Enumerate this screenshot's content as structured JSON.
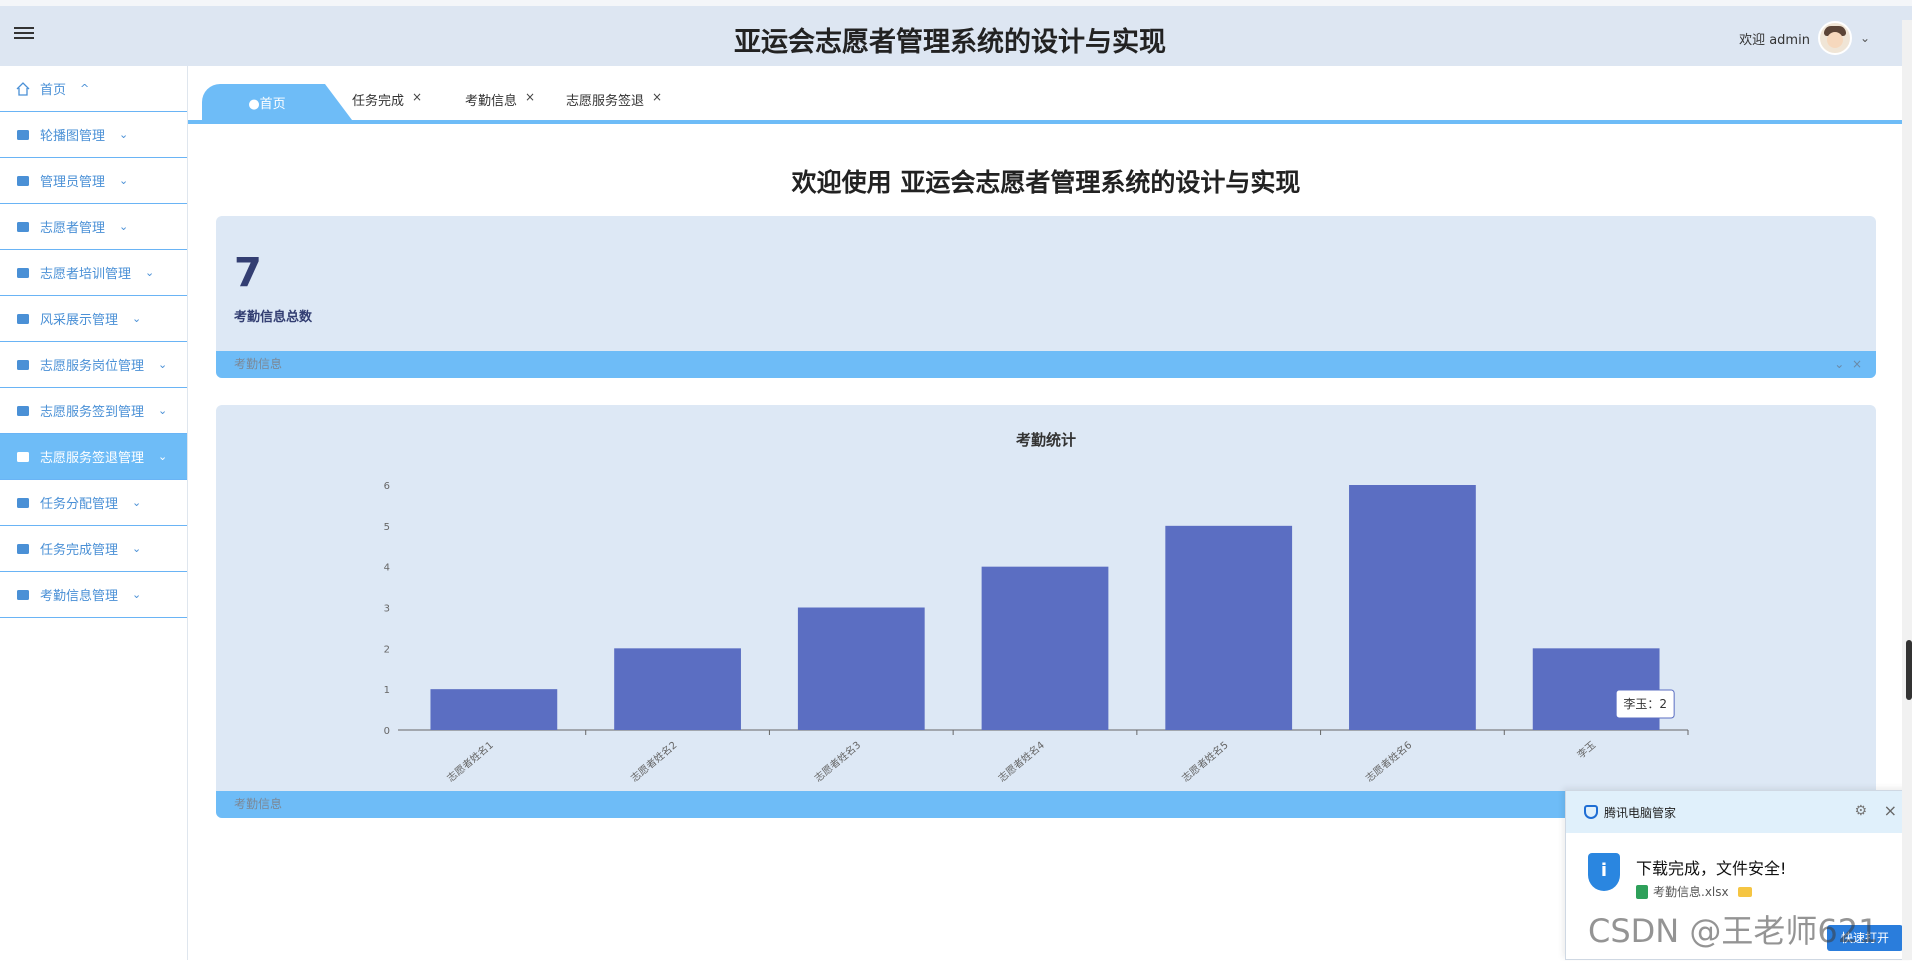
{
  "header": {
    "title": "亚运会志愿者管理系统的设计与实现",
    "welcome": "欢迎 admin"
  },
  "sidebar": {
    "items": [
      {
        "label": "首页",
        "chevron": "^",
        "icon": "home-icon"
      },
      {
        "label": "轮播图管理",
        "chevron": "⌄",
        "icon": "carousel-icon"
      },
      {
        "label": "管理员管理",
        "chevron": "⌄",
        "icon": "admin-icon"
      },
      {
        "label": "志愿者管理",
        "chevron": "⌄",
        "icon": "volunteer-icon"
      },
      {
        "label": "志愿者培训管理",
        "chevron": "⌄",
        "icon": "training-icon"
      },
      {
        "label": "风采展示管理",
        "chevron": "⌄",
        "icon": "display-icon"
      },
      {
        "label": "志愿服务岗位管理",
        "chevron": "⌄",
        "icon": "post-icon"
      },
      {
        "label": "志愿服务签到管理",
        "chevron": "⌄",
        "icon": "checkin-icon"
      },
      {
        "label": "志愿服务签退管理",
        "chevron": "⌄",
        "icon": "checkout-icon"
      },
      {
        "label": "任务分配管理",
        "chevron": "⌄",
        "icon": "task-assign-icon"
      },
      {
        "label": "任务完成管理",
        "chevron": "⌄",
        "icon": "task-done-icon"
      },
      {
        "label": "考勤信息管理",
        "chevron": "⌄",
        "icon": "attendance-icon"
      }
    ],
    "active_index": 8
  },
  "tabs": {
    "home": "●首页",
    "items": [
      {
        "label": "任务完成",
        "close": "×"
      },
      {
        "label": "考勤信息",
        "close": "×"
      },
      {
        "label": "志愿服务签退",
        "close": "×"
      }
    ]
  },
  "main": {
    "welcome_heading": "欢迎使用 亚运会志愿者管理系统的设计与实现",
    "stat_card": {
      "value": "7",
      "label": "考勤信息总数",
      "footer": "考勤信息",
      "ctrl_collapse": "⌄",
      "ctrl_close": "×"
    },
    "chart_card": {
      "footer": "考勤信息"
    }
  },
  "chart_data": {
    "type": "bar",
    "title": "考勤统计",
    "categories": [
      "志愿者姓名1",
      "志愿者姓名2",
      "志愿者姓名3",
      "志愿者姓名4",
      "志愿者姓名5",
      "志愿者姓名6",
      "李玉"
    ],
    "values": [
      1,
      2,
      3,
      4,
      5,
      6,
      2
    ],
    "ylim": [
      0,
      6
    ],
    "yticks": [
      "0",
      "1",
      "2",
      "3",
      "4",
      "5",
      "6"
    ],
    "color": "#5b6ec2",
    "tooltip": "李玉：2",
    "xlabel": "",
    "ylabel": ""
  },
  "toast": {
    "app": "腾讯电脑管家",
    "title": "下载完成，文件安全!",
    "file": "考勤信息.xlsx",
    "open_btn": "快速打开",
    "gear": "⚙",
    "close": "×"
  },
  "watermark": "CSDN @王老师621"
}
